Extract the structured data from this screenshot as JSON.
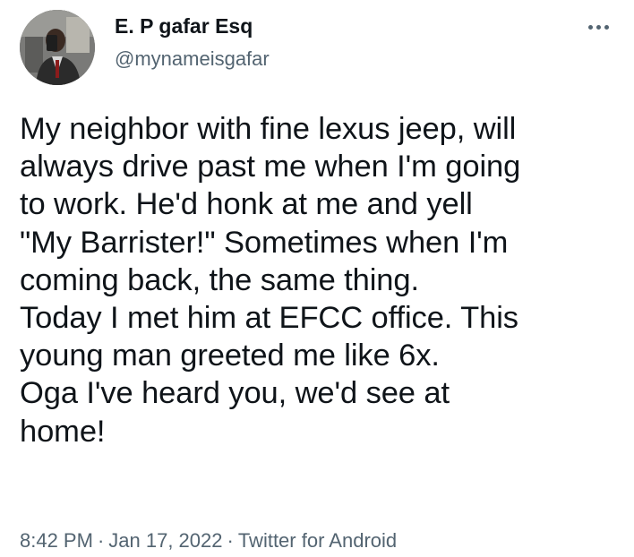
{
  "author": {
    "display_name": "E. P gafar Esq",
    "handle": "@mynameisgafar",
    "avatar_icon": "profile-photo"
  },
  "menu": {
    "more_icon": "more-horizontal-icon"
  },
  "tweet": {
    "lines": [
      "My neighbor with fine lexus jeep, will",
      "always drive past me when I'm going",
      "to work. He'd honk at me and yell",
      "\"My Barrister!\" Sometimes when I'm",
      "coming back, the same thing.",
      "Today I met him at EFCC office. This",
      "young man greeted me like 6x.",
      "Oga I've heard you, we'd see at",
      "home!"
    ]
  },
  "meta": {
    "time": "8:42 PM",
    "separator": "·",
    "date": "Jan 17, 2022",
    "source": "Twitter for Android"
  },
  "colors": {
    "text": "#0f1419",
    "secondary_text": "#536471",
    "background": "#ffffff"
  }
}
